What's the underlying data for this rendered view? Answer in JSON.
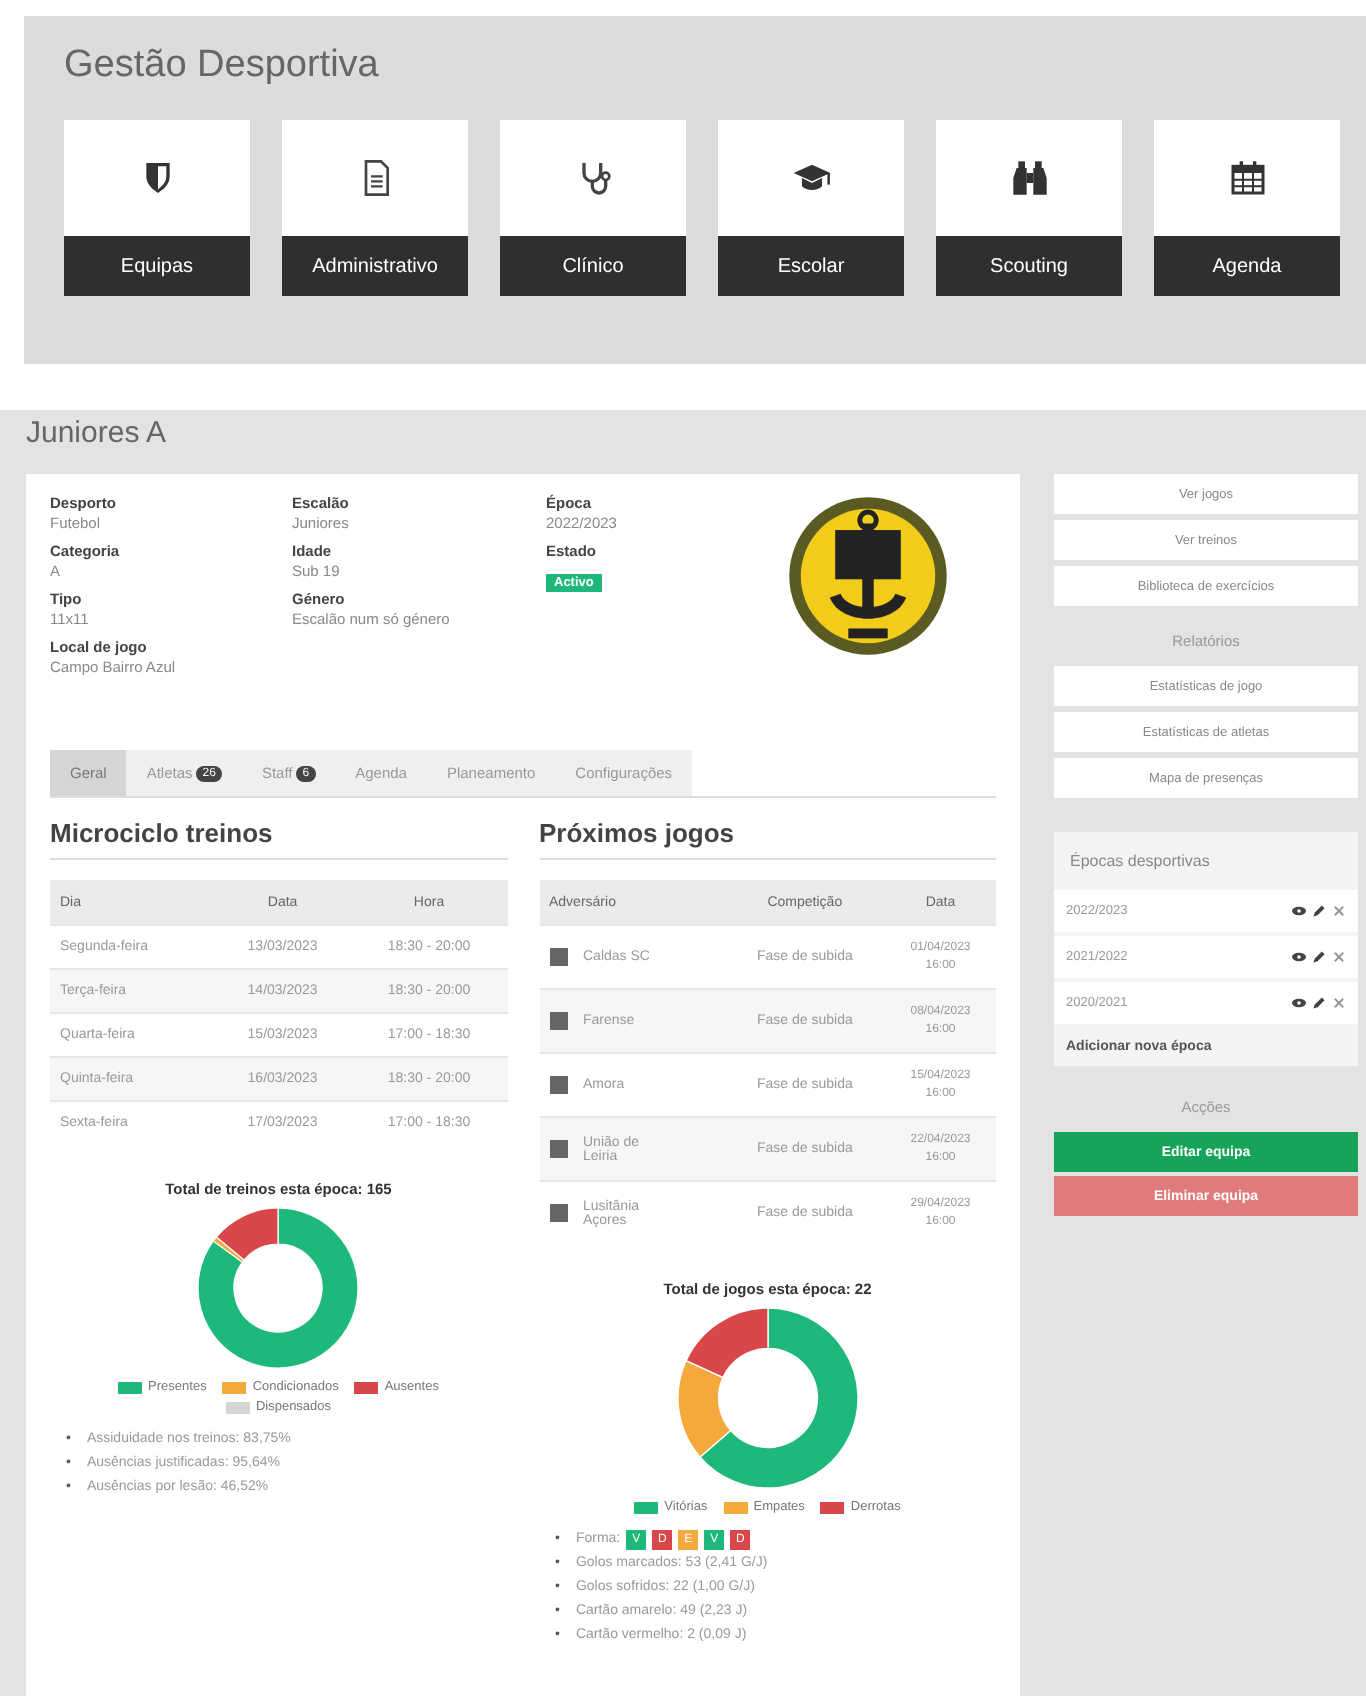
{
  "header": {
    "title": "Gestão Desportiva"
  },
  "modules": [
    {
      "label": "Equipas"
    },
    {
      "label": "Administrativo"
    },
    {
      "label": "Clínico"
    },
    {
      "label": "Escolar"
    },
    {
      "label": "Scouting"
    },
    {
      "label": "Agenda"
    }
  ],
  "team": {
    "title": "Juniores A",
    "info_columns": [
      [
        {
          "label": "Desporto",
          "value": "Futebol"
        },
        {
          "label": "Categoria",
          "value": "A"
        },
        {
          "label": "Tipo",
          "value": "11x11"
        },
        {
          "label": "Local de jogo",
          "value": "Campo Bairro Azul"
        }
      ],
      [
        {
          "label": "Escalão",
          "value": "Juniores"
        },
        {
          "label": "Idade",
          "value": "Sub 19"
        },
        {
          "label": "Género",
          "value": "Escalão num só género"
        }
      ],
      [
        {
          "label": "Época",
          "value": "2022/2023"
        },
        {
          "label": "Estado",
          "value": "Activo",
          "kind": "badge"
        }
      ]
    ]
  },
  "tabs": [
    {
      "label": "Geral",
      "selected": true
    },
    {
      "label": "Atletas",
      "count": "26",
      "selected": false
    },
    {
      "label": "Staff",
      "count": "6",
      "selected": false
    },
    {
      "label": "Agenda",
      "selected": false
    },
    {
      "label": "Planeamento",
      "selected": false
    },
    {
      "label": "Configurações",
      "selected": false
    }
  ],
  "training": {
    "title": "Microciclo treinos",
    "columns": [
      "Dia",
      "Data",
      "Hora"
    ],
    "rows": [
      [
        "Segunda-feira",
        "13/03/2023",
        "18:30 - 20:00"
      ],
      [
        "Terça-feira",
        "14/03/2023",
        "18:30 - 20:00"
      ],
      [
        "Quarta-feira",
        "15/03/2023",
        "17:00 - 18:30"
      ],
      [
        "Quinta-feira",
        "16/03/2023",
        "18:30 - 20:00"
      ],
      [
        "Sexta-feira",
        "17/03/2023",
        "17:00 - 18:30"
      ]
    ]
  },
  "training_summary": {
    "title": "Total de treinos esta época: 165",
    "legend": [
      {
        "label": "Presentes",
        "color": "#1db87a"
      },
      {
        "label": "Condicionados",
        "color": "#f3a93c"
      },
      {
        "label": "Ausentes",
        "color": "#d9474a"
      },
      {
        "label": "Dispensados",
        "color": "#d6d6d6"
      }
    ],
    "bullet": "•",
    "notes": [
      "Assiduidade nos treinos: 83,75%",
      "Ausências justificadas: 95,64%",
      "Ausências por lesão: 46,52%"
    ]
  },
  "games": {
    "title": "Próximos jogos",
    "columns": [
      "Adversário",
      "Competição",
      "Data"
    ],
    "rows": [
      {
        "opponent": "Caldas SC",
        "competition": "Fase de subida",
        "date": "01/04/2023",
        "time": "16:00"
      },
      {
        "opponent": "Farense",
        "competition": "Fase de subida",
        "date": "08/04/2023",
        "time": "16:00"
      },
      {
        "opponent": "Amora",
        "competition": "Fase de subida",
        "date": "15/04/2023",
        "time": "16:00"
      },
      {
        "opponent": "União de Leiria",
        "competition": "Fase de subida",
        "date": "22/04/2023",
        "time": "16:00"
      },
      {
        "opponent": "Lusitânia Açores",
        "competition": "Fase de subida",
        "date": "29/04/2023",
        "time": "16:00"
      }
    ]
  },
  "games_summary": {
    "title": "Total de jogos esta época: 22",
    "legend": [
      {
        "label": "Vitórias",
        "color": "#1db87a"
      },
      {
        "label": "Empates",
        "color": "#f3a93c"
      },
      {
        "label": "Derrotas",
        "color": "#d9474a"
      }
    ],
    "form": {
      "label": "Forma:",
      "results": [
        {
          "letter": "V",
          "color": "#1db87a"
        },
        {
          "letter": "D",
          "color": "#d9474a"
        },
        {
          "letter": "E",
          "color": "#f3a93c"
        },
        {
          "letter": "V",
          "color": "#1db87a"
        },
        {
          "letter": "D",
          "color": "#d9474a"
        }
      ]
    },
    "bullet": "•",
    "notes": [
      "Golos marcados: 53 (2,41 G/J)",
      "Golos sofridos: 22 (1,00 G/J)",
      "Cartão amarelo: 49 (2,23 J)",
      "Cartão vermelho: 2 (0,09 J)"
    ]
  },
  "sidebar": {
    "links": [
      "Ver jogos",
      "Ver treinos",
      "Biblioteca de exercícios"
    ],
    "reports_title": "Relatórios",
    "reports": [
      "Estatísticas de jogo",
      "Estatísticas de atletas",
      "Mapa de presenças"
    ],
    "seasons": {
      "title": "Épocas desportivas",
      "items": [
        "2022/2023",
        "2021/2022",
        "2020/2021"
      ],
      "add": "Adicionar nova época"
    },
    "actions_title": "Acções",
    "actions": [
      {
        "label": "Editar equipa",
        "kind": "primary"
      },
      {
        "label": "Eliminar equipa",
        "kind": "danger"
      }
    ]
  }
}
